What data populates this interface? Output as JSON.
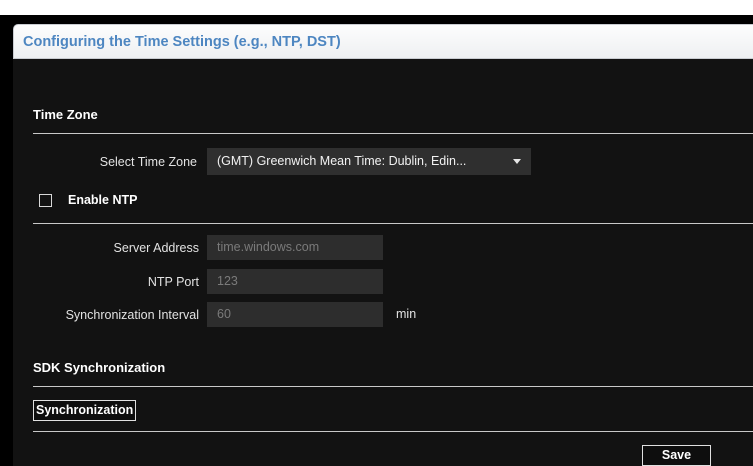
{
  "page": {
    "title": "Configuring the Time Settings (e.g., NTP, DST)"
  },
  "time_zone": {
    "header": "Time Zone",
    "select_label": "Select Time Zone",
    "selected_value": "(GMT) Greenwich Mean Time: Dublin, Edin..."
  },
  "ntp": {
    "enable_label": "Enable NTP",
    "enabled": false,
    "server_address_label": "Server Address",
    "server_address_value": "time.windows.com",
    "port_label": "NTP Port",
    "port_value": "123",
    "interval_label": "Synchronization Interval",
    "interval_value": "60",
    "interval_unit": "min"
  },
  "sdk": {
    "header": "SDK Synchronization",
    "sync_button": "Synchronization"
  },
  "footer": {
    "save_button": "Save"
  },
  "colors": {
    "title_text": "#4d86c1",
    "panel_bg": "#121212",
    "field_bg": "#2d2d2d"
  },
  "icons": [
    "checkbox-icon",
    "caret-down-icon"
  ]
}
